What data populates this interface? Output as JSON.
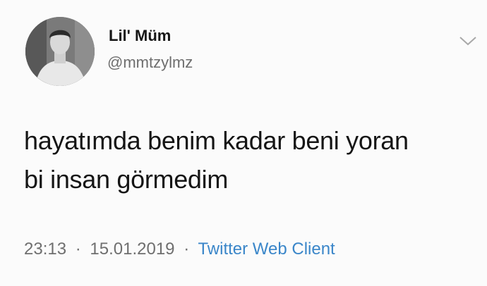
{
  "user": {
    "display_name": "Lil' Müm",
    "handle": "@mmtzylmz",
    "avatar": "profile-photo"
  },
  "menu": {
    "icon": "chevron-down-icon"
  },
  "tweet": {
    "lines": [
      "hayatımda benim kadar beni yoran",
      "bi insan görmedim"
    ]
  },
  "meta": {
    "time": "23:13",
    "date": "15.01.2019",
    "separator": "·",
    "client": "Twitter Web Client"
  },
  "colors": {
    "client_link": "#3a86c9",
    "secondary_text": "#6e6e6e"
  }
}
